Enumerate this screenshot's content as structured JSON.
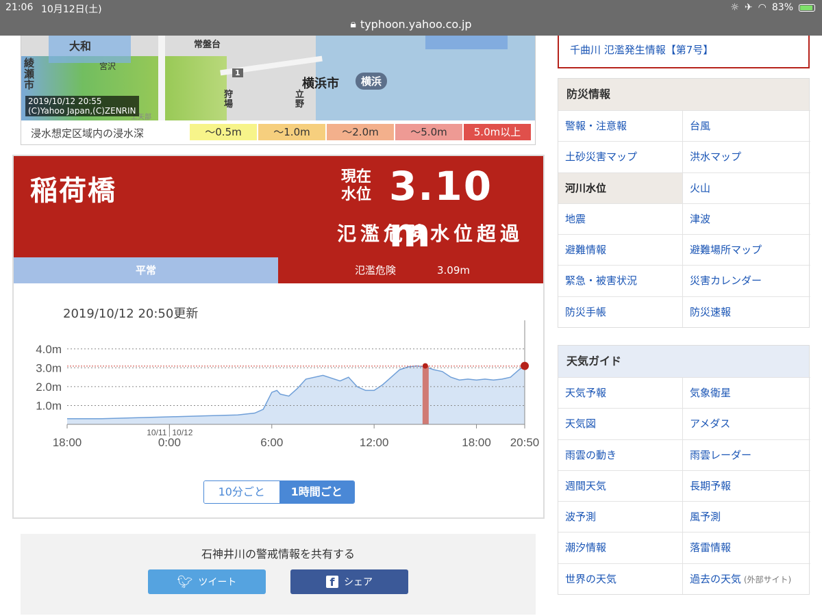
{
  "status_bar": {
    "time": "21:06",
    "date": "10月12日(土)",
    "battery": "83%"
  },
  "browser": {
    "url": "typhoon.yahoo.co.jp"
  },
  "map": {
    "labels": [
      "大和",
      "綾瀬市",
      "宮沢",
      "常盤台",
      "狩場",
      "立野",
      "上矢部"
    ],
    "city": "横浜市",
    "station": "横浜",
    "route": "1",
    "timestamp": "2019/10/12 20:55",
    "copyright": "(C)Yahoo Japan,(C)ZENRIN"
  },
  "legend": {
    "title": "浸水想定区域内の浸水深",
    "items": [
      {
        "label": "～0.5m",
        "color": "#f7f48a"
      },
      {
        "label": "～1.0m",
        "color": "#f6cf7e"
      },
      {
        "label": "～2.0m",
        "color": "#f3b08c"
      },
      {
        "label": "～5.0m",
        "color": "#ee9a94"
      },
      {
        "label": "5.0m以上",
        "color": "#e0504b"
      }
    ]
  },
  "gauge": {
    "station_name": "稲荷橋",
    "current_label_1": "現在",
    "current_label_2": "水位",
    "level": "3.10 m",
    "status": "氾濫危険水位超過",
    "normal_label": "平常",
    "danger_label": "氾濫危険",
    "danger_value": "3.09m",
    "updated": "2019/10/12 20:50更新",
    "toggle_10min": "10分ごと",
    "toggle_1hour": "1時間ごと"
  },
  "chart_data": {
    "type": "area",
    "ylabel": "",
    "yticks": [
      "1.0m",
      "2.0m",
      "3.0m",
      "4.0m"
    ],
    "ylim": [
      0,
      4.5
    ],
    "xticks": [
      "18:00",
      "0:00",
      "6:00",
      "12:00",
      "18:00",
      "20:50"
    ],
    "date_marks": [
      "10/11",
      "10/12"
    ],
    "danger_level": 3.09,
    "current_value": 3.1,
    "x_hours": [
      0,
      2,
      4,
      6,
      8,
      10,
      11,
      11.5,
      12,
      12.3,
      12.5,
      13,
      13.5,
      14,
      15,
      16,
      16.5,
      17,
      17.5,
      18,
      18.5,
      19,
      19.5,
      20,
      20.5,
      21,
      21.5,
      22,
      22.5,
      23,
      23.5,
      24,
      24.5,
      25,
      25.5,
      26,
      26.5,
      26.83
    ],
    "values": [
      0.3,
      0.3,
      0.35,
      0.4,
      0.45,
      0.5,
      0.6,
      0.8,
      1.7,
      1.8,
      1.6,
      1.5,
      1.9,
      2.4,
      2.6,
      2.3,
      2.5,
      2.0,
      1.8,
      1.8,
      2.1,
      2.5,
      2.9,
      3.05,
      3.1,
      3.05,
      2.9,
      2.8,
      2.5,
      2.35,
      2.4,
      2.35,
      2.4,
      2.35,
      2.4,
      2.5,
      2.9,
      3.1
    ],
    "bar_at_hour": 21,
    "grid": "dotted"
  },
  "share": {
    "title": "石神井川の警戒情報を共有する",
    "tweet": "ツイート",
    "share": "シェア"
  },
  "alert": {
    "link": "千曲川 氾濫発生情報【第7号】"
  },
  "bousai": {
    "title": "防災情報",
    "items": [
      "警報・注意報",
      "台風",
      "土砂災害マップ",
      "洪水マップ",
      "河川水位",
      "火山",
      "地震",
      "津波",
      "避難情報",
      "避難場所マップ",
      "緊急・被害状況",
      "災害カレンダー",
      "防災手帳",
      "防災速報"
    ],
    "current": "河川水位"
  },
  "weather": {
    "title": "天気ガイド",
    "items": [
      "天気予報",
      "気象衛星",
      "天気図",
      "アメダス",
      "雨雲の動き",
      "雨雲レーダー",
      "週間天気",
      "長期予報",
      "波予測",
      "風予測",
      "潮汐情報",
      "落雷情報",
      "世界の天気",
      "過去の天気"
    ],
    "ext_note": "(外部サイト)"
  },
  "colors": {
    "alert_red": "#b6221a",
    "link_blue": "#1a55b5",
    "normal_blue": "#a4bfe6"
  }
}
